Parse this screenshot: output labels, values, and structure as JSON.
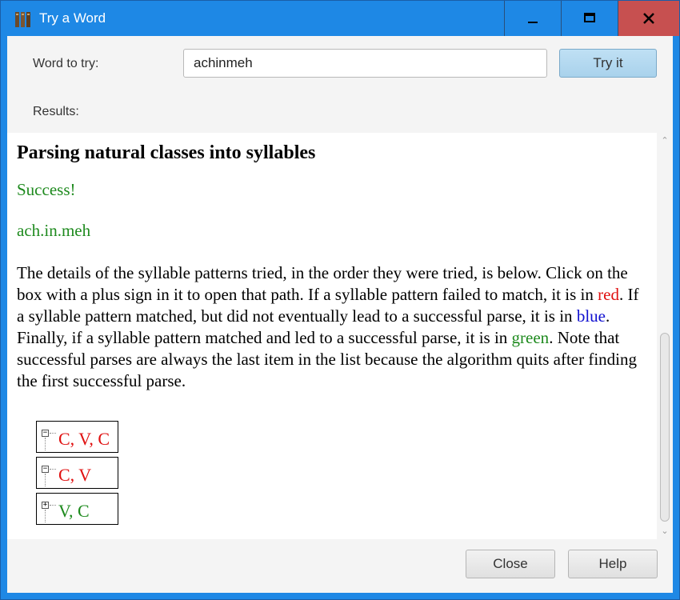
{
  "window": {
    "title": "Try a Word",
    "controls": {
      "minimize": "minimize",
      "maximize": "maximize",
      "close": "close"
    }
  },
  "form": {
    "word_label": "Word to try:",
    "word_value": "achinmeh",
    "try_button": "Try it",
    "results_label": "Results:"
  },
  "results": {
    "heading": "Parsing natural classes into syllables",
    "status": "Success!",
    "parse": "ach.in.meh",
    "details": {
      "p1": "The details of the syllable patterns tried, in the order they were tried, is below. Click on the box with a plus sign in it to open that path. If a syllable pattern failed to match, it is in ",
      "red_word": "red",
      "p2": ". If a syllable pattern matched, but did not eventually lead to a successful parse, it is in ",
      "blue_word": "blue",
      "p3": ". Finally, if a syllable pattern matched and led to a successful parse, it is in ",
      "green_word": "green",
      "p4": ". Note that successful parses are always the last item in the list because the algorithm quits after finding the first successful parse."
    },
    "tree": [
      {
        "toggle": "−",
        "label": "C, V, C",
        "color": "#e01010"
      },
      {
        "toggle": "−",
        "label": "C, V",
        "color": "#e01010"
      },
      {
        "toggle": "+",
        "label": "V, C",
        "color": "#1e8a1e"
      }
    ]
  },
  "footer": {
    "close_button": "Close",
    "help_button": "Help"
  },
  "colors": {
    "titlebar": "#1e88e5",
    "close_hover": "#c75050",
    "fail": "#e01010",
    "partial": "#1010d0",
    "success": "#1e8a1e"
  }
}
